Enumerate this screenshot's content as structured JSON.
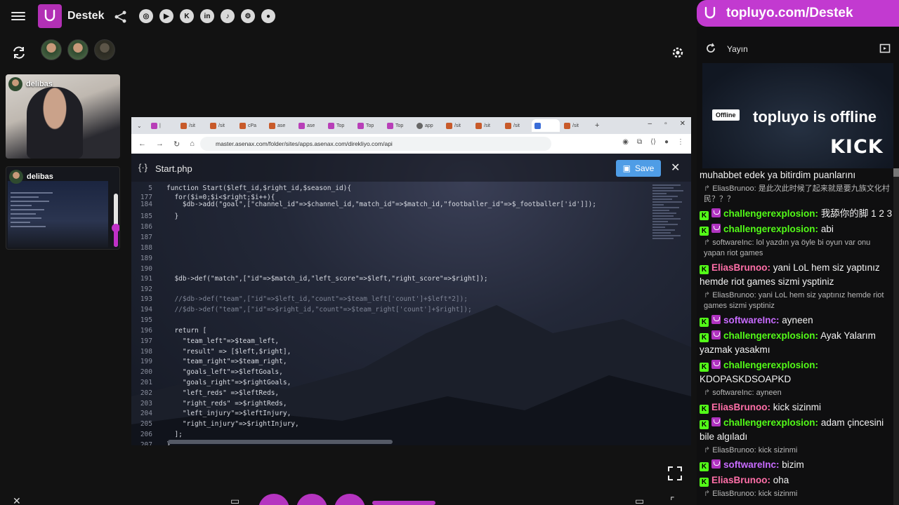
{
  "brand": {
    "name": "Destek",
    "accent": "#b230b5"
  },
  "socials": [
    {
      "icon": "instagram-icon",
      "glyph": "◎"
    },
    {
      "icon": "youtube-icon",
      "glyph": "▶"
    },
    {
      "icon": "kick-icon",
      "glyph": "K"
    },
    {
      "icon": "linkedin-icon",
      "glyph": "in"
    },
    {
      "icon": "tiktok-icon",
      "glyph": "♪"
    },
    {
      "icon": "steam-icon",
      "glyph": "⚙"
    },
    {
      "icon": "github-icon",
      "glyph": "●"
    }
  ],
  "participants": [
    {
      "name": "delibas"
    },
    {
      "name": "delibas"
    }
  ],
  "volume_level": 0.35,
  "browser": {
    "url": "master.asenax.com/folder/sites/apps.asenax.com/direkliyo.com/api",
    "tabs": [
      "|",
      "/sit",
      "/sit",
      "cPa",
      "ase",
      "ase",
      "Top",
      "Top",
      "Top",
      "app",
      "/sit",
      "/sit",
      "/sit",
      "",
      "/sit"
    ]
  },
  "editor": {
    "filename": "Start.php",
    "save_label": "Save",
    "lines": [
      {
        "n": "5",
        "code": "function Start($left_id,$right_id,$season_id){"
      },
      {
        "n": "177",
        "code": "  for($i=0;$i<$right;$i++){"
      },
      {
        "n": "184",
        "code": "    $db->add(\"goal\",[\"channel_id\"=>$channel_id,\"match_id\"=>$match_id,\"footballer_id\"=>$_footballer['id']]);"
      },
      {
        "n": "185",
        "code": "  }"
      },
      {
        "n": "186",
        "code": ""
      },
      {
        "n": "187",
        "code": ""
      },
      {
        "n": "188",
        "code": ""
      },
      {
        "n": "189",
        "code": ""
      },
      {
        "n": "190",
        "code": ""
      },
      {
        "n": "191",
        "code": "  $db->def(\"match\",[\"id\"=>$match_id,\"left_score\"=>$left,\"right_score\"=>$right]);"
      },
      {
        "n": "192",
        "code": ""
      },
      {
        "n": "193",
        "code": "  //$db->def(\"team\",[\"id\"=>$left_id,\"count\"=>$team_left['count']+$left*2]);"
      },
      {
        "n": "194",
        "code": "  //$db->def(\"team\",[\"id\"=>$right_id,\"count\"=>$team_right['count']+$right]);"
      },
      {
        "n": "195",
        "code": ""
      },
      {
        "n": "196",
        "code": "  return ["
      },
      {
        "n": "197",
        "code": "    \"team_left\"=>$team_left,"
      },
      {
        "n": "198",
        "code": "    \"result\" => [$left,$right],"
      },
      {
        "n": "199",
        "code": "    \"team_right\"=>$team_right,"
      },
      {
        "n": "200",
        "code": "    \"goals_left\"=>$leftGoals,"
      },
      {
        "n": "201",
        "code": "    \"goals_right\"=>$rightGoals,"
      },
      {
        "n": "202",
        "code": "    \"left_reds\" =>$leftReds,"
      },
      {
        "n": "203",
        "code": "    \"right_reds\" =>$rightReds,"
      },
      {
        "n": "204",
        "code": "    \"left_injury\"=>$leftInjury,"
      },
      {
        "n": "205",
        "code": "    \"right_injury\"=>$rightInjury,"
      },
      {
        "n": "206",
        "code": "  ];"
      },
      {
        "n": "207",
        "code": "}"
      }
    ]
  },
  "promo": {
    "text": "topluyo.com/Destek"
  },
  "panel": {
    "title": "Yayın",
    "offline_badge": "Offline",
    "offline_title": "topluyo is offline",
    "kick_logo": "KICK"
  },
  "chat": [
    {
      "type": "text",
      "text": "muhabbet edek ya bitirdim puanlarını"
    },
    {
      "type": "reply",
      "text": "EliasBrunoo: 是此次此时候了起来就是要九族文化村民？？？"
    },
    {
      "type": "msg",
      "badges": [
        "kick",
        "sub"
      ],
      "user": "challengerexplosion:",
      "color": "#53fc18",
      "text": "我舔你的脚 1 2 3"
    },
    {
      "type": "msg",
      "badges": [
        "kick",
        "sub"
      ],
      "user": "challengerexplosion:",
      "color": "#53fc18",
      "text": "abi"
    },
    {
      "type": "reply",
      "text": "softwareInc: lol yazdın ya öyle bi oyun var onu yapan riot games"
    },
    {
      "type": "msg",
      "badges": [
        "kick"
      ],
      "user": "EliasBrunoo:",
      "color": "#ff6fa8",
      "text": "yani LoL hem siz yaptınız hemde riot games sizmi ysptiniz"
    },
    {
      "type": "reply",
      "text": "EliasBrunoo: yani LoL hem siz yaptınız hemde riot games sizmi ysptiniz"
    },
    {
      "type": "msg",
      "badges": [
        "kick",
        "sub"
      ],
      "user": "softwareInc:",
      "color": "#c86bff",
      "text": "ayneen"
    },
    {
      "type": "msg",
      "badges": [
        "kick",
        "sub"
      ],
      "user": "challengerexplosion:",
      "color": "#53fc18",
      "text": "Ayak Yalarım yazmak yasakmı"
    },
    {
      "type": "msg",
      "badges": [
        "kick",
        "sub"
      ],
      "user": "challengerexplosion:",
      "color": "#53fc18",
      "text": "KDOPASKDSOAPKD"
    },
    {
      "type": "reply",
      "text": "softwareInc: ayneen"
    },
    {
      "type": "msg",
      "badges": [
        "kick"
      ],
      "user": "EliasBrunoo:",
      "color": "#ff6fa8",
      "text": "kick sizinmi"
    },
    {
      "type": "msg",
      "badges": [
        "kick",
        "sub"
      ],
      "user": "challengerexplosion:",
      "color": "#53fc18",
      "text": "adam çincesini bile algıladı"
    },
    {
      "type": "reply",
      "text": "EliasBrunoo: kick sizinmi"
    },
    {
      "type": "msg",
      "badges": [
        "kick",
        "sub"
      ],
      "user": "softwareInc:",
      "color": "#c86bff",
      "text": "bizim"
    },
    {
      "type": "msg",
      "badges": [
        "kick"
      ],
      "user": "EliasBrunoo:",
      "color": "#ff6fa8",
      "text": "oha"
    },
    {
      "type": "reply",
      "text": "EliasBrunoo: kick sizinmi"
    }
  ]
}
